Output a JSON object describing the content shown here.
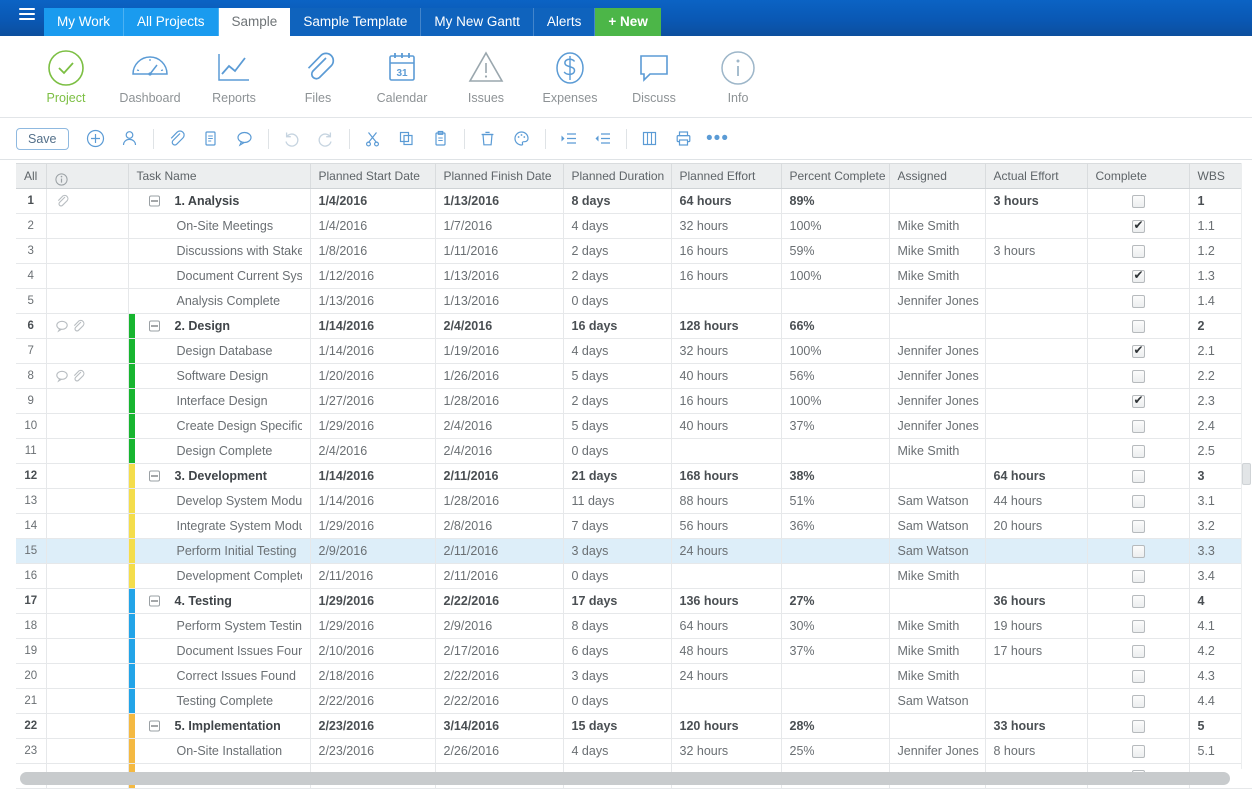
{
  "topbar": {
    "menu_icon": "hamburger-icon",
    "tabs": [
      {
        "label": "My Work",
        "style": "bright"
      },
      {
        "label": "All Projects",
        "style": "bright"
      },
      {
        "label": "Sample",
        "style": "active"
      },
      {
        "label": "Sample Template",
        "style": "dark"
      },
      {
        "label": "My New Gantt",
        "style": "dark"
      },
      {
        "label": "Alerts",
        "style": "dark"
      },
      {
        "label": "+ New",
        "style": "new"
      }
    ],
    "colors": {
      "bright": "#1a9bef",
      "dark": "#0f63bd",
      "new": "#4cb648",
      "bar": "#0a58b4"
    }
  },
  "modules": [
    {
      "label": "Project",
      "icon": "check-circle-icon",
      "active": true
    },
    {
      "label": "Dashboard",
      "icon": "gauge-icon",
      "active": false
    },
    {
      "label": "Reports",
      "icon": "line-chart-icon",
      "active": false
    },
    {
      "label": "Files",
      "icon": "paperclip-icon",
      "active": false
    },
    {
      "label": "Calendar",
      "icon": "calendar-icon",
      "active": false,
      "day": "31"
    },
    {
      "label": "Issues",
      "icon": "warning-triangle-icon",
      "active": false
    },
    {
      "label": "Expenses",
      "icon": "dollar-circle-icon",
      "active": false
    },
    {
      "label": "Discuss",
      "icon": "speech-bubble-icon",
      "active": false
    },
    {
      "label": "Info",
      "icon": "info-circle-icon",
      "active": false
    }
  ],
  "toolbar": {
    "save_label": "Save",
    "icons": [
      "add-task-icon",
      "add-person-icon",
      "sep",
      "attach-icon",
      "notes-icon",
      "comment-icon",
      "sep",
      "undo-icon",
      "redo-icon",
      "sep",
      "cut-icon",
      "copy-icon",
      "paste-icon",
      "sep",
      "delete-icon",
      "palette-icon",
      "sep",
      "indent-icon",
      "outdent-icon",
      "sep",
      "columns-icon",
      "print-icon",
      "more-icon"
    ]
  },
  "grid": {
    "columns": [
      "All",
      "",
      "Task Name",
      "Planned Start Date",
      "Planned Finish Date",
      "Planned Duration",
      "Planned Effort",
      "Percent Complete",
      "Assigned",
      "Actual Effort",
      "Complete",
      "WBS"
    ],
    "info_header_icon": "info-circle-icon",
    "colors": {
      "analysis": "#ffffff",
      "design": "#17b52f",
      "development": "#f4dd4b",
      "testing": "#22a4e8",
      "implementation": "#f4b942"
    },
    "rows": [
      {
        "n": "1",
        "icons": [
          "paperclip-icon"
        ],
        "bar": "",
        "task": "1. Analysis",
        "summary": true,
        "start": "1/4/2016",
        "finish": "1/13/2016",
        "duration": "8 days",
        "effort": "64 hours",
        "percent": "89%",
        "assigned": "",
        "actual": "3 hours",
        "complete": false,
        "wbs": "1"
      },
      {
        "n": "2",
        "icons": [],
        "bar": "",
        "task": "On-Site Meetings",
        "summary": false,
        "start": "1/4/2016",
        "finish": "1/7/2016",
        "duration": "4 days",
        "effort": "32 hours",
        "percent": "100%",
        "assigned": "Mike Smith",
        "actual": "",
        "complete": true,
        "wbs": "1.1"
      },
      {
        "n": "3",
        "icons": [],
        "bar": "",
        "task": "Discussions with Stakeholders",
        "summary": false,
        "start": "1/8/2016",
        "finish": "1/11/2016",
        "duration": "2 days",
        "effort": "16 hours",
        "percent": "59%",
        "assigned": "Mike Smith",
        "actual": "3 hours",
        "complete": false,
        "wbs": "1.2"
      },
      {
        "n": "4",
        "icons": [],
        "bar": "",
        "task": "Document Current Systems",
        "summary": false,
        "start": "1/12/2016",
        "finish": "1/13/2016",
        "duration": "2 days",
        "effort": "16 hours",
        "percent": "100%",
        "assigned": "Mike Smith",
        "actual": "",
        "complete": true,
        "wbs": "1.3"
      },
      {
        "n": "5",
        "icons": [],
        "bar": "",
        "task": "Analysis Complete",
        "summary": false,
        "start": "1/13/2016",
        "finish": "1/13/2016",
        "duration": "0 days",
        "effort": "",
        "percent": "",
        "assigned": "Jennifer Jones",
        "actual": "",
        "complete": false,
        "wbs": "1.4"
      },
      {
        "n": "6",
        "icons": [
          "comment-icon",
          "paperclip-icon"
        ],
        "bar": "design",
        "task": "2. Design",
        "summary": true,
        "start": "1/14/2016",
        "finish": "2/4/2016",
        "duration": "16 days",
        "effort": "128 hours",
        "percent": "66%",
        "assigned": "",
        "actual": "",
        "complete": false,
        "wbs": "2"
      },
      {
        "n": "7",
        "icons": [],
        "bar": "design",
        "task": "Design Database",
        "summary": false,
        "start": "1/14/2016",
        "finish": "1/19/2016",
        "duration": "4 days",
        "effort": "32 hours",
        "percent": "100%",
        "assigned": "Jennifer Jones",
        "actual": "",
        "complete": true,
        "wbs": "2.1"
      },
      {
        "n": "8",
        "icons": [
          "comment-icon",
          "paperclip-icon"
        ],
        "bar": "design",
        "task": "Software Design",
        "summary": false,
        "start": "1/20/2016",
        "finish": "1/26/2016",
        "duration": "5 days",
        "effort": "40 hours",
        "percent": "56%",
        "assigned": "Jennifer Jones",
        "actual": "",
        "complete": false,
        "wbs": "2.2"
      },
      {
        "n": "9",
        "icons": [],
        "bar": "design",
        "task": "Interface Design",
        "summary": false,
        "start": "1/27/2016",
        "finish": "1/28/2016",
        "duration": "2 days",
        "effort": "16 hours",
        "percent": "100%",
        "assigned": "Jennifer Jones",
        "actual": "",
        "complete": true,
        "wbs": "2.3"
      },
      {
        "n": "10",
        "icons": [],
        "bar": "design",
        "task": "Create Design Specifications",
        "summary": false,
        "start": "1/29/2016",
        "finish": "2/4/2016",
        "duration": "5 days",
        "effort": "40 hours",
        "percent": "37%",
        "assigned": "Jennifer Jones",
        "actual": "",
        "complete": false,
        "wbs": "2.4"
      },
      {
        "n": "11",
        "icons": [],
        "bar": "design",
        "task": "Design Complete",
        "summary": false,
        "start": "2/4/2016",
        "finish": "2/4/2016",
        "duration": "0 days",
        "effort": "",
        "percent": "",
        "assigned": "Mike Smith",
        "actual": "",
        "complete": false,
        "wbs": "2.5"
      },
      {
        "n": "12",
        "icons": [],
        "bar": "development",
        "task": "3. Development",
        "summary": true,
        "start": "1/14/2016",
        "finish": "2/11/2016",
        "duration": "21 days",
        "effort": "168 hours",
        "percent": "38%",
        "assigned": "",
        "actual": "64 hours",
        "complete": false,
        "wbs": "3"
      },
      {
        "n": "13",
        "icons": [],
        "bar": "development",
        "task": "Develop System Modules",
        "summary": false,
        "start": "1/14/2016",
        "finish": "1/28/2016",
        "duration": "11 days",
        "effort": "88 hours",
        "percent": "51%",
        "assigned": "Sam Watson",
        "actual": "44 hours",
        "complete": false,
        "wbs": "3.1"
      },
      {
        "n": "14",
        "icons": [],
        "bar": "development",
        "task": "Integrate System Modules",
        "summary": false,
        "start": "1/29/2016",
        "finish": "2/8/2016",
        "duration": "7 days",
        "effort": "56 hours",
        "percent": "36%",
        "assigned": "Sam Watson",
        "actual": "20 hours",
        "complete": false,
        "wbs": "3.2"
      },
      {
        "n": "15",
        "icons": [],
        "bar": "development",
        "task": "Perform Initial Testing",
        "summary": false,
        "start": "2/9/2016",
        "finish": "2/11/2016",
        "duration": "3 days",
        "effort": "24 hours",
        "percent": "",
        "assigned": "Sam Watson",
        "actual": "",
        "complete": false,
        "wbs": "3.3",
        "selected": true
      },
      {
        "n": "16",
        "icons": [],
        "bar": "development",
        "task": "Development Complete",
        "summary": false,
        "start": "2/11/2016",
        "finish": "2/11/2016",
        "duration": "0 days",
        "effort": "",
        "percent": "",
        "assigned": "Mike Smith",
        "actual": "",
        "complete": false,
        "wbs": "3.4"
      },
      {
        "n": "17",
        "icons": [],
        "bar": "testing",
        "task": "4. Testing",
        "summary": true,
        "start": "1/29/2016",
        "finish": "2/22/2016",
        "duration": "17 days",
        "effort": "136 hours",
        "percent": "27%",
        "assigned": "",
        "actual": "36 hours",
        "complete": false,
        "wbs": "4"
      },
      {
        "n": "18",
        "icons": [],
        "bar": "testing",
        "task": "Perform System Testing",
        "summary": false,
        "start": "1/29/2016",
        "finish": "2/9/2016",
        "duration": "8 days",
        "effort": "64 hours",
        "percent": "30%",
        "assigned": "Mike Smith",
        "actual": "19 hours",
        "complete": false,
        "wbs": "4.1"
      },
      {
        "n": "19",
        "icons": [],
        "bar": "testing",
        "task": "Document Issues Found",
        "summary": false,
        "start": "2/10/2016",
        "finish": "2/17/2016",
        "duration": "6 days",
        "effort": "48 hours",
        "percent": "37%",
        "assigned": "Mike Smith",
        "actual": "17 hours",
        "complete": false,
        "wbs": "4.2"
      },
      {
        "n": "20",
        "icons": [],
        "bar": "testing",
        "task": "Correct Issues Found",
        "summary": false,
        "start": "2/18/2016",
        "finish": "2/22/2016",
        "duration": "3 days",
        "effort": "24 hours",
        "percent": "",
        "assigned": "Mike Smith",
        "actual": "",
        "complete": false,
        "wbs": "4.3"
      },
      {
        "n": "21",
        "icons": [],
        "bar": "testing",
        "task": "Testing Complete",
        "summary": false,
        "start": "2/22/2016",
        "finish": "2/22/2016",
        "duration": "0 days",
        "effort": "",
        "percent": "",
        "assigned": "Sam Watson",
        "actual": "",
        "complete": false,
        "wbs": "4.4"
      },
      {
        "n": "22",
        "icons": [],
        "bar": "implementation",
        "task": "5. Implementation",
        "summary": true,
        "start": "2/23/2016",
        "finish": "3/14/2016",
        "duration": "15 days",
        "effort": "120 hours",
        "percent": "28%",
        "assigned": "",
        "actual": "33 hours",
        "complete": false,
        "wbs": "5"
      },
      {
        "n": "23",
        "icons": [],
        "bar": "implementation",
        "task": "On-Site Installation",
        "summary": false,
        "start": "2/23/2016",
        "finish": "2/26/2016",
        "duration": "4 days",
        "effort": "32 hours",
        "percent": "25%",
        "assigned": "Jennifer Jones",
        "actual": "8 hours",
        "complete": false,
        "wbs": "5.1"
      },
      {
        "n": "",
        "icons": [],
        "bar": "implementation",
        "task": "",
        "summary": false,
        "start": "",
        "finish": "",
        "duration": "",
        "effort": "",
        "percent": "",
        "assigned": "",
        "actual": "",
        "complete": false,
        "wbs": ""
      }
    ]
  }
}
